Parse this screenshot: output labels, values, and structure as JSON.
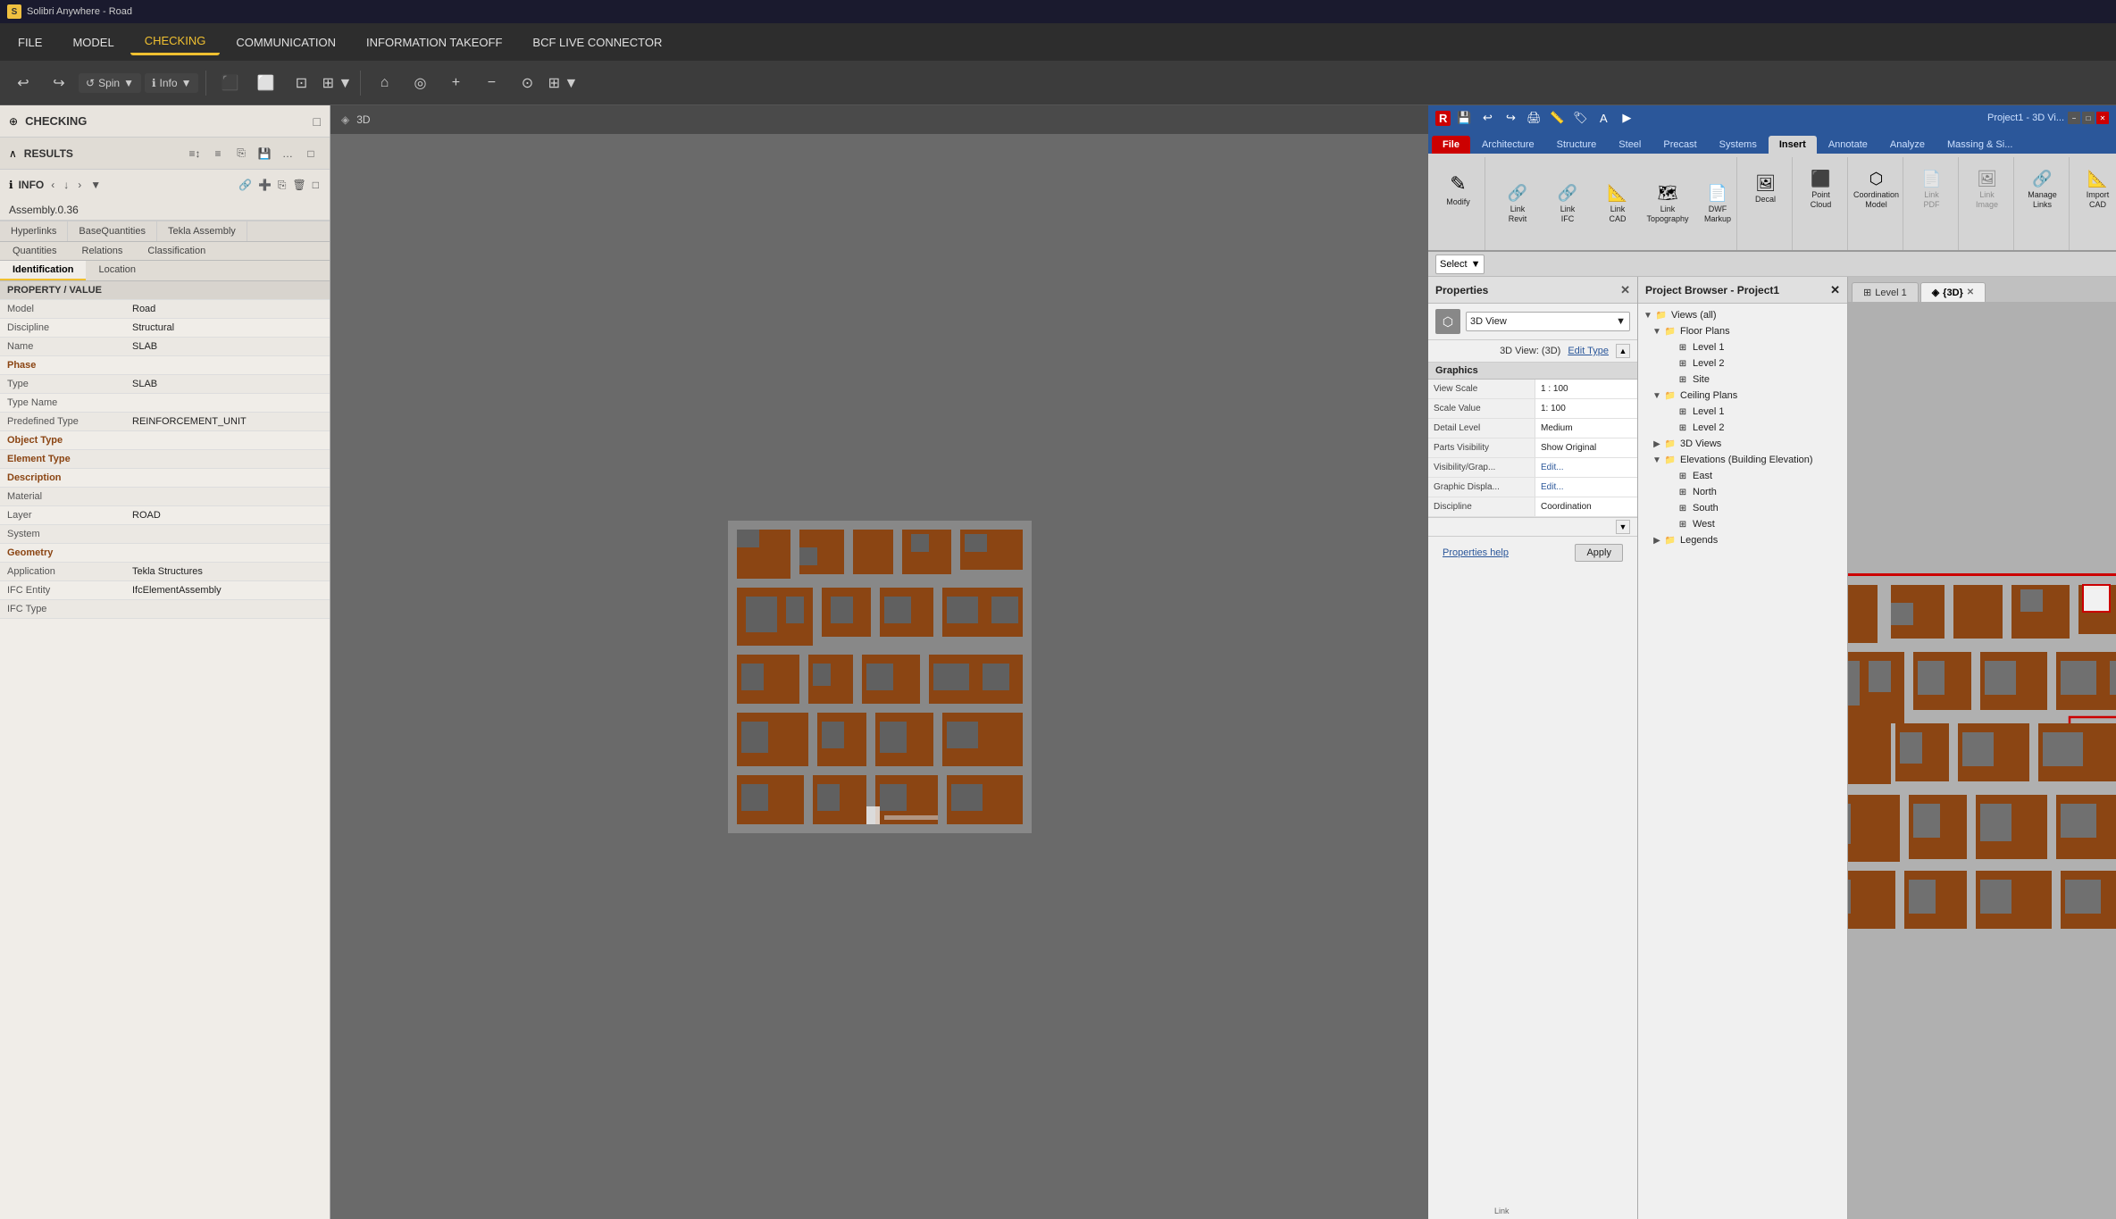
{
  "titleBar": {
    "appName": "Solibri Anywhere - Road"
  },
  "menuBar": {
    "items": [
      {
        "id": "file",
        "label": "FILE"
      },
      {
        "id": "model",
        "label": "MODEL"
      },
      {
        "id": "checking",
        "label": "CHECKING",
        "active": true
      },
      {
        "id": "communication",
        "label": "COMMUNICATION"
      },
      {
        "id": "information_takeoff",
        "label": "INFORMATION TAKEOFF"
      },
      {
        "id": "bcf",
        "label": "BCF LIVE CONNECTOR"
      }
    ]
  },
  "toolbar": {
    "spinLabel": "Spin",
    "infoLabel": "Info"
  },
  "leftPanel": {
    "title": "CHECKING",
    "resultsLabel": "RESULTS",
    "infoLabel": "INFO",
    "assemblyLabel": "Assembly.0.36",
    "tabs": [
      {
        "id": "hyperlinks",
        "label": "Hyperlinks"
      },
      {
        "id": "basequantities",
        "label": "BaseQuantities"
      },
      {
        "id": "teklaassembly",
        "label": "Tekla Assembly"
      }
    ],
    "subTabs": [
      {
        "id": "quantities",
        "label": "Quantities"
      },
      {
        "id": "relations",
        "label": "Relations"
      },
      {
        "id": "classification",
        "label": "Classification"
      }
    ],
    "subTabsRow2": [
      {
        "id": "identification",
        "label": "Identification",
        "active": true
      },
      {
        "id": "location",
        "label": "Location"
      }
    ],
    "properties": [
      {
        "label": "Property",
        "value": "Value",
        "isHeader": true
      },
      {
        "label": "Model",
        "value": "Road"
      },
      {
        "label": "Discipline",
        "value": "Structural"
      },
      {
        "label": "Name",
        "value": "SLAB"
      },
      {
        "label": "Phase",
        "value": ""
      },
      {
        "label": "Type",
        "value": "SLAB"
      },
      {
        "label": "Type Name",
        "value": ""
      },
      {
        "label": "Predefined Type",
        "value": "REINFORCEMENT_UNIT"
      },
      {
        "label": "Object Type",
        "value": ""
      },
      {
        "label": "Element Type",
        "value": ""
      },
      {
        "label": "Description",
        "value": ""
      },
      {
        "label": "Material",
        "value": ""
      },
      {
        "label": "Layer",
        "value": "ROAD"
      },
      {
        "label": "System",
        "value": ""
      },
      {
        "label": "Geometry",
        "value": ""
      },
      {
        "label": "Application",
        "value": "Tekla Structures"
      },
      {
        "label": "IFC Entity",
        "value": "IfcElementAssembly"
      },
      {
        "label": "IFC Type",
        "value": ""
      }
    ]
  },
  "view3D": {
    "label": "3D"
  },
  "revit": {
    "titleBar": {
      "appName": "Project1 - 3D Vi...",
      "windowBtns": [
        "−",
        "□",
        "✕"
      ]
    },
    "ribbonTabs": [
      {
        "id": "file",
        "label": "File",
        "active": false
      },
      {
        "id": "architecture",
        "label": "Architecture"
      },
      {
        "id": "structure",
        "label": "Structure"
      },
      {
        "id": "steel",
        "label": "Steel"
      },
      {
        "id": "precast",
        "label": "Precast"
      },
      {
        "id": "systems",
        "label": "Systems"
      },
      {
        "id": "insert",
        "label": "Insert",
        "active": true
      },
      {
        "id": "annotate",
        "label": "Annotate"
      },
      {
        "id": "analyze",
        "label": "Analyze"
      },
      {
        "id": "massing",
        "label": "Massing & Si..."
      }
    ],
    "ribbon": {
      "modifyGroup": {
        "label": "Modify",
        "icon": "✎"
      },
      "linkGroup": {
        "label": "Link",
        "buttons": [
          {
            "id": "link-revit",
            "label": "Link\nRevit",
            "icon": "🔗"
          },
          {
            "id": "link-ifc",
            "label": "Link\nIFC",
            "icon": "🔗"
          },
          {
            "id": "link-cad",
            "label": "Link\nCAD",
            "icon": "📐"
          },
          {
            "id": "link-topography",
            "label": "Link\nTopography",
            "icon": "🗺"
          },
          {
            "id": "dwf-markup",
            "label": "DWF\nMarkup",
            "icon": "📄"
          }
        ]
      },
      "decalGroup": {
        "label": "Decal",
        "icon": "🖼"
      },
      "pointCloudGroup": {
        "label": "Point\nCloud",
        "icon": "⬛"
      },
      "coordinationGroup": {
        "label": "Coordination\nModel",
        "icon": "⬡"
      },
      "linkPdfGroup": {
        "label": "Link\nPDF",
        "icon": "📄",
        "disabled": true
      },
      "linkImageGroup": {
        "label": "Link\nImage",
        "icon": "🖼",
        "disabled": true
      },
      "manageLinksGroup": {
        "label": "Manage\nLinks",
        "icon": "🔗"
      },
      "importCADGroup": {
        "label": "Import\nCAD",
        "icon": "📐"
      }
    },
    "selectBar": {
      "label": "Select",
      "dropdownArrow": "▼"
    },
    "viewTabs": [
      {
        "id": "level1",
        "label": "Level 1",
        "icon": "⊞"
      },
      {
        "id": "3d",
        "label": "{3D}",
        "icon": "◈",
        "active": true,
        "closeable": true
      }
    ],
    "properties": {
      "title": "Properties",
      "type": "3D View",
      "sectionTitle": "3D View: (3D)",
      "editTypeLabel": "Edit Type",
      "sections": [
        {
          "id": "graphics",
          "label": "Graphics",
          "rows": [
            {
              "label": "View Scale",
              "value": "1 : 100"
            },
            {
              "label": "Scale Value",
              "value": "1: 100"
            },
            {
              "label": "Detail Level",
              "value": "Medium"
            },
            {
              "label": "Parts Visibility",
              "value": "Show Original"
            },
            {
              "label": "Visibility/Grap...",
              "value": "Edit...",
              "isLink": true
            },
            {
              "label": "Graphic Displa...",
              "value": "Edit...",
              "isLink": true
            },
            {
              "label": "Discipline",
              "value": "Coordination"
            }
          ]
        }
      ],
      "helpLink": "Properties help",
      "applyButton": "Apply"
    },
    "projectBrowser": {
      "title": "Project Browser - Project1",
      "tree": [
        {
          "label": "Views (all)",
          "level": 0,
          "expanded": true,
          "type": "folder"
        },
        {
          "label": "Floor Plans",
          "level": 1,
          "expanded": true,
          "type": "folder"
        },
        {
          "label": "Level 1",
          "level": 2,
          "type": "view"
        },
        {
          "label": "Level 2",
          "level": 2,
          "type": "view"
        },
        {
          "label": "Site",
          "level": 2,
          "type": "view"
        },
        {
          "label": "Ceiling Plans",
          "level": 1,
          "expanded": true,
          "type": "folder"
        },
        {
          "label": "Level 1",
          "level": 2,
          "type": "view"
        },
        {
          "label": "Level 2",
          "level": 2,
          "type": "view"
        },
        {
          "label": "3D Views",
          "level": 1,
          "expanded": false,
          "type": "folder"
        },
        {
          "label": "Elevations (Building Elevation)",
          "level": 1,
          "expanded": true,
          "type": "folder"
        },
        {
          "label": "East",
          "level": 2,
          "type": "view"
        },
        {
          "label": "North",
          "level": 2,
          "type": "view"
        },
        {
          "label": "South",
          "level": 2,
          "type": "view"
        },
        {
          "label": "West",
          "level": 2,
          "type": "view"
        },
        {
          "label": "Legends",
          "level": 1,
          "expanded": false,
          "type": "folder"
        }
      ]
    }
  },
  "colors": {
    "accent": "#f0c030",
    "revitBlue": "#2b579a",
    "brown": "#8B4513",
    "floorplanBrown": "#8B4513",
    "floorplanGray": "#606060"
  }
}
